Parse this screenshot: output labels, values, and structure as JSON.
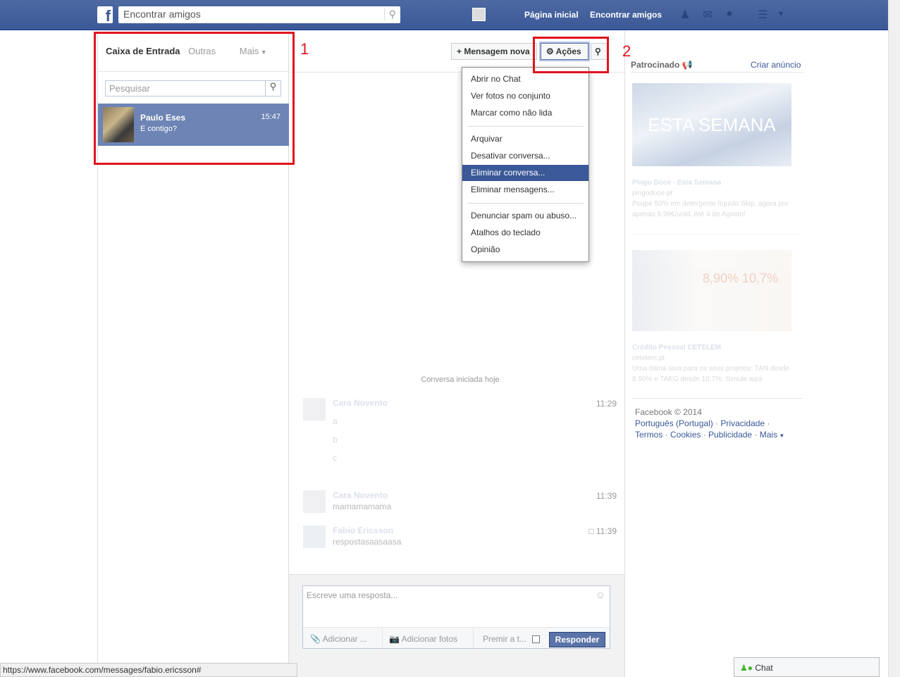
{
  "header": {
    "search_placeholder": "Encontrar amigos",
    "links": [
      "Página inicial",
      "Encontrar amigos"
    ]
  },
  "inbox": {
    "tabs": [
      "Caixa de Entrada",
      "Outras",
      "Mais"
    ],
    "search_placeholder": "Pesquisar",
    "conversations": [
      {
        "name": "Paulo Eses",
        "snippet": "E contigo?",
        "time": "15:47"
      }
    ]
  },
  "toolbar": {
    "new_message": "Mensagem nova",
    "actions": "Ações"
  },
  "actions_menu": {
    "items": [
      "Abrir no Chat",
      "Ver fotos no conjunto",
      "Marcar como não lida",
      "Arquivar",
      "Desativar conversa...",
      "Eliminar conversa...",
      "Eliminar mensagens...",
      "Denunciar spam ou abuso...",
      "Atalhos do teclado",
      "Opinião"
    ],
    "selected": "Eliminar conversa..."
  },
  "thread": {
    "started": "Conversa iniciada hoje",
    "messages": [
      {
        "author": "Cara Novento",
        "time": "11:29",
        "lines": [
          "a",
          "b",
          "c"
        ]
      },
      {
        "author": "Cara Novento",
        "time": "11:39",
        "lines": [
          "mamamamama"
        ]
      },
      {
        "author": "Fabio Ericsson",
        "time": "11:39",
        "lines": [
          "respostasaasaasa"
        ]
      }
    ]
  },
  "composer": {
    "placeholder": "Escreve uma resposta...",
    "attach": "Adicionar ...",
    "photos": "Adicionar fotos",
    "enter_label": "Premir a t...",
    "reply": "Responder"
  },
  "sidebar": {
    "sponsored": "Patrocinado",
    "create_ad": "Criar anúncio",
    "ads": [
      {
        "image_text": "ESTA SEMANA",
        "title": "Pingo Doce - Esta Semana",
        "domain": "pingodoce.pt",
        "text": "Poupe 50% em detergente líquido Skip, agora por apenas 8,99€/unid. Até 4 de Agosto!"
      },
      {
        "image_text": "8,90% 10,7%",
        "title": "Crédito Pessoal CETELEM",
        "domain": "cetelem.pt",
        "text": "Uma ótima taxa para os seus projetos: TAN desde 8.90% e TAEG desde 10.7%. Simule aqui"
      }
    ],
    "footer": {
      "copyright": "Facebook © 2014",
      "links": [
        "Português (Portugal)",
        "Privacidade",
        "Termos",
        "Cookies",
        "Publicidade",
        "Mais"
      ]
    }
  },
  "annotations": [
    "1",
    "2"
  ],
  "status_url": "https://www.facebook.com/messages/fabio.ericsson#",
  "chat": {
    "label": "Chat"
  }
}
